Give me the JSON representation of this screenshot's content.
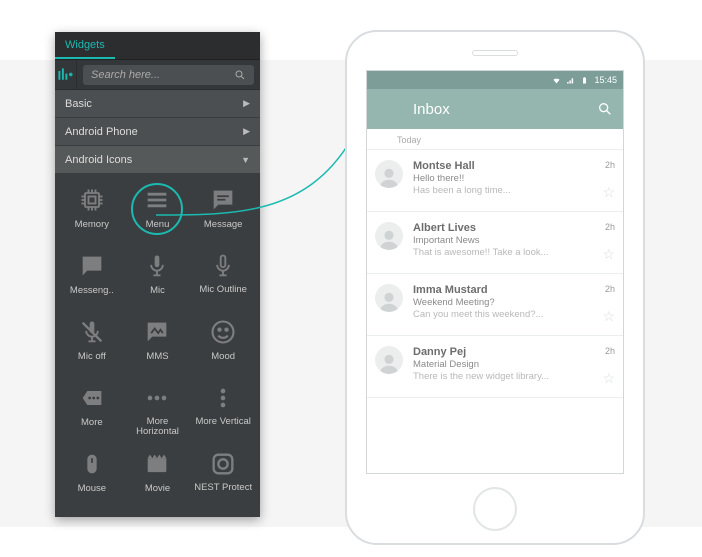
{
  "sidebar": {
    "tab_label": "Widgets",
    "search_placeholder": "Search here...",
    "categories": [
      {
        "label": "Basic",
        "expanded": false
      },
      {
        "label": "Android Phone",
        "expanded": false
      },
      {
        "label": "Android Icons",
        "expanded": true
      }
    ],
    "icons": [
      {
        "id": "memory",
        "label": "Memory"
      },
      {
        "id": "menu",
        "label": "Menu",
        "highlighted": true
      },
      {
        "id": "message",
        "label": "Message"
      },
      {
        "id": "messenger",
        "label": "Messeng.."
      },
      {
        "id": "mic",
        "label": "Mic"
      },
      {
        "id": "mic-outline",
        "label": "Mic Outline"
      },
      {
        "id": "mic-off",
        "label": "Mic off"
      },
      {
        "id": "mms",
        "label": "MMS"
      },
      {
        "id": "mood",
        "label": "Mood"
      },
      {
        "id": "more",
        "label": "More"
      },
      {
        "id": "more-horizontal",
        "label": "More Horizontal"
      },
      {
        "id": "more-vertical",
        "label": "More Vertical"
      },
      {
        "id": "mouse",
        "label": "Mouse"
      },
      {
        "id": "movie",
        "label": "Movie"
      },
      {
        "id": "nest-protect",
        "label": "NEST Protect"
      }
    ]
  },
  "phone": {
    "status_time": "15:45",
    "app_title": "Inbox",
    "day_label": "Today",
    "emails": [
      {
        "from": "Montse Hall",
        "subject": "Hello there!!",
        "preview": "Has been a long time...",
        "time": "2h"
      },
      {
        "from": "Albert Lives",
        "subject": "Important News",
        "preview": "That is awesome!! Take a look...",
        "time": "2h"
      },
      {
        "from": "Imma Mustard",
        "subject": "Weekend Meeting?",
        "preview": "Can you meet this weekend?...",
        "time": "2h"
      },
      {
        "from": "Danny Pej",
        "subject": "Material Design",
        "preview": "There is the new widget library...",
        "time": "2h"
      }
    ]
  },
  "colors": {
    "accent": "#1bbab0",
    "appbar": "#95b5af"
  }
}
